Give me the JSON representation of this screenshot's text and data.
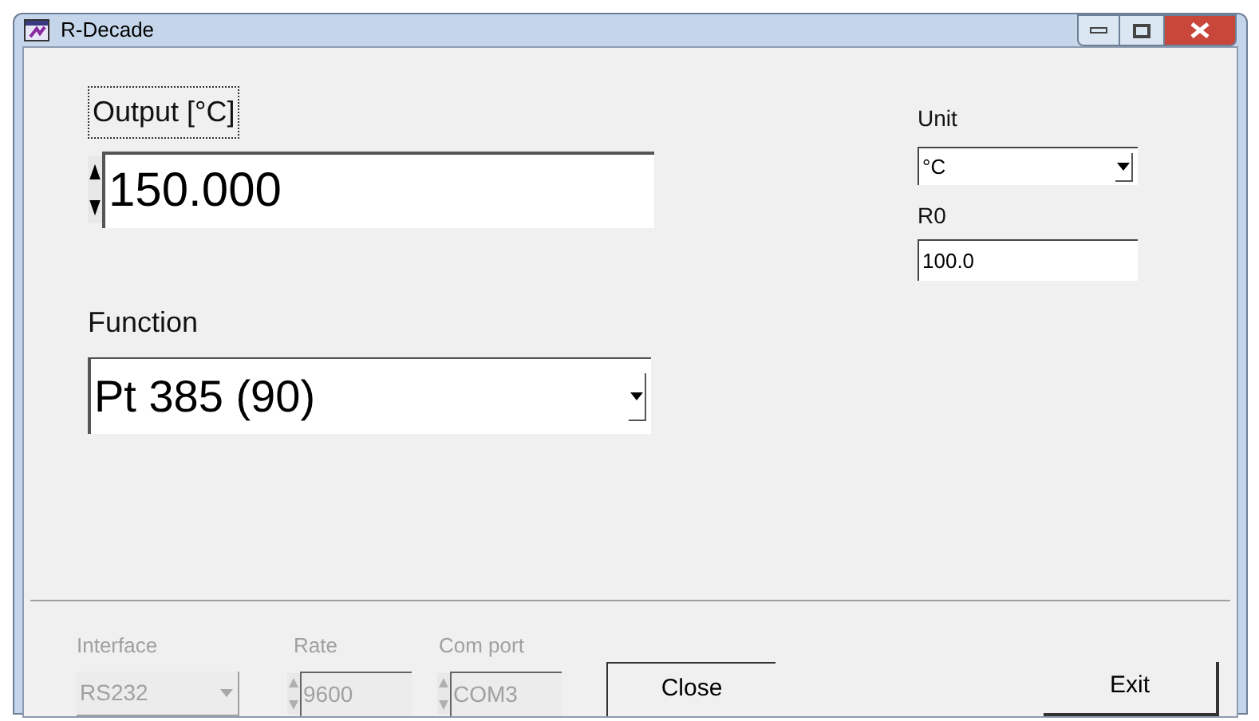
{
  "window": {
    "title": "R-Decade"
  },
  "output": {
    "label": "Output [°C]",
    "focused": true,
    "value": "150.000"
  },
  "function": {
    "label": "Function",
    "value": "Pt 385 (90)"
  },
  "unit": {
    "label": "Unit",
    "value": "°C"
  },
  "r0": {
    "label": "R0",
    "value": "100.0"
  },
  "interface": {
    "label": "Interface",
    "value": "RS232",
    "disabled": true
  },
  "rate": {
    "label": "Rate",
    "value": "9600",
    "disabled": true
  },
  "com_port": {
    "label": "Com port",
    "value": "COM3",
    "disabled": true
  },
  "buttons": [
    {
      "label": "Close",
      "kind": "sunken"
    },
    {
      "label": "Exit",
      "kind": "raised"
    }
  ]
}
